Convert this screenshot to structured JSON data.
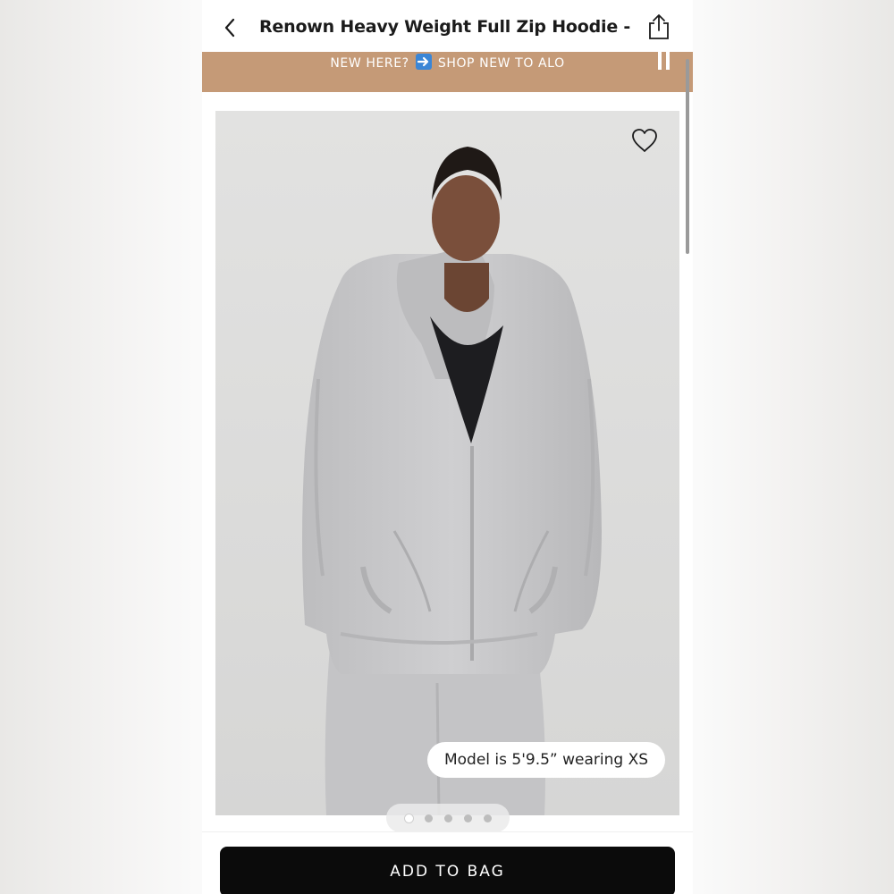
{
  "header": {
    "title": "Renown Heavy Weight Full Zip Hoodie - Ath...",
    "back_icon": "chevron-left-icon",
    "share_icon": "share-icon"
  },
  "promo": {
    "text_before": "NEW HERE?",
    "arrow_icon": "right-arrow-emoji-icon",
    "text_after": "SHOP NEW TO ALO",
    "pause_icon": "pause-icon",
    "background_color": "#c59a77"
  },
  "product_image": {
    "caption": "Model is 5'9.5” wearing XS",
    "wishlist_icon": "heart-icon",
    "carousel": {
      "total": 5,
      "active": 1
    }
  },
  "actions": {
    "add_to_bag_label": "ADD TO BAG"
  }
}
